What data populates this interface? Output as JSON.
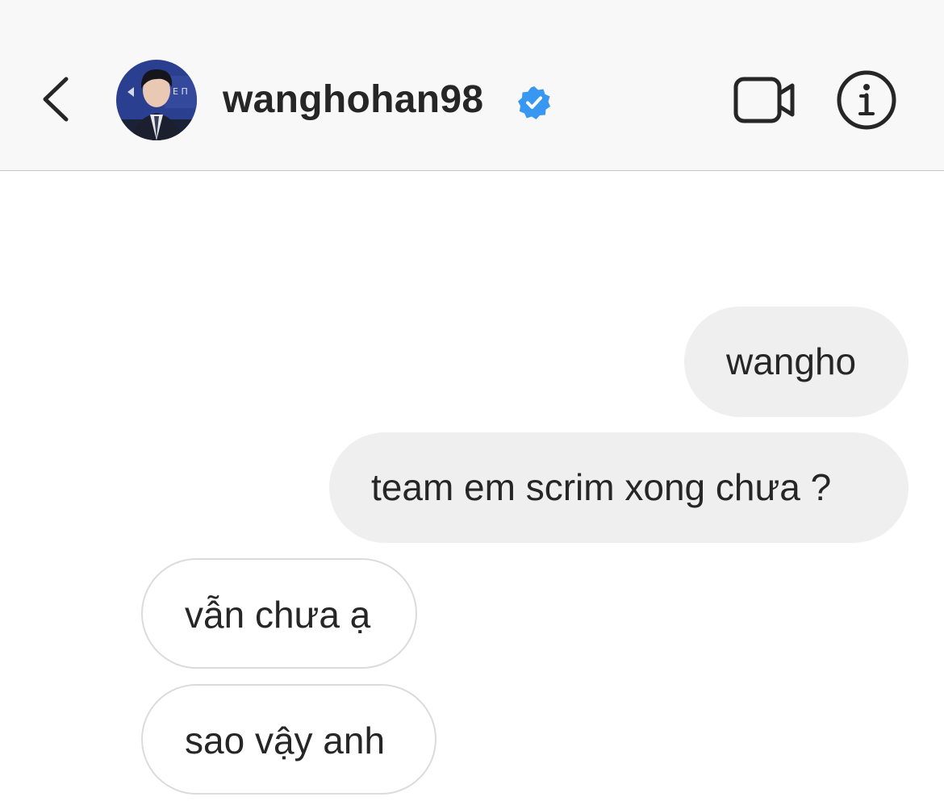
{
  "header": {
    "username": "wanghohan98",
    "verified": true,
    "icons": {
      "back": "chevron-left-icon",
      "verified": "verified-badge-icon",
      "video": "video-camera-icon",
      "info": "info-circle-icon"
    },
    "colors": {
      "verified_badge": "#3897f0",
      "header_bg": "#f8f8f8"
    }
  },
  "messages": [
    {
      "direction": "outgoing",
      "text": "wangho"
    },
    {
      "direction": "outgoing",
      "text": "team em scrim xong chưa ?"
    },
    {
      "direction": "incoming",
      "text": "vẫn chưa ạ"
    },
    {
      "direction": "incoming",
      "text": "sao vậy anh"
    }
  ]
}
